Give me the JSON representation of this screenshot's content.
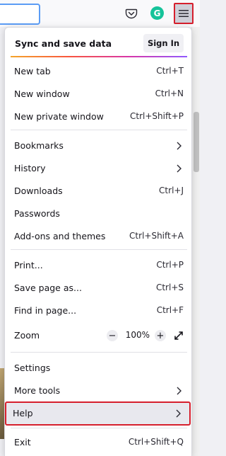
{
  "panel": {
    "sync_label": "Sync and save data",
    "sign_in_label": "Sign In"
  },
  "toolbar": {
    "grammarly_glyph": "G"
  },
  "icons": {
    "pocket": "pocket-icon",
    "grammarly": "grammarly-icon",
    "menu": "hamburger-menu-icon",
    "chevron": "chevron-right-icon",
    "fullscreen": "fullscreen-icon"
  },
  "menu": {
    "new_tab": {
      "label": "New tab",
      "shortcut": "Ctrl+T"
    },
    "new_window": {
      "label": "New window",
      "shortcut": "Ctrl+N"
    },
    "new_private_window": {
      "label": "New private window",
      "shortcut": "Ctrl+Shift+P"
    },
    "bookmarks": {
      "label": "Bookmarks"
    },
    "history": {
      "label": "History"
    },
    "downloads": {
      "label": "Downloads",
      "shortcut": "Ctrl+J"
    },
    "passwords": {
      "label": "Passwords"
    },
    "addons": {
      "label": "Add-ons and themes",
      "shortcut": "Ctrl+Shift+A"
    },
    "print": {
      "label": "Print...",
      "shortcut": "Ctrl+P"
    },
    "save_page": {
      "label": "Save page as...",
      "shortcut": "Ctrl+S"
    },
    "find": {
      "label": "Find in page...",
      "shortcut": "Ctrl+F"
    },
    "zoom": {
      "label": "Zoom",
      "minus": "−",
      "value": "100%",
      "plus": "+"
    },
    "settings": {
      "label": "Settings"
    },
    "more_tools": {
      "label": "More tools"
    },
    "help": {
      "label": "Help"
    },
    "exit": {
      "label": "Exit",
      "shortcut": "Ctrl+Shift+Q"
    }
  },
  "colors": {
    "highlight_border": "#d61f2d",
    "accent_gradient": [
      "#f4a52b",
      "#f8553e",
      "#d836a8",
      "#9059ff"
    ]
  }
}
